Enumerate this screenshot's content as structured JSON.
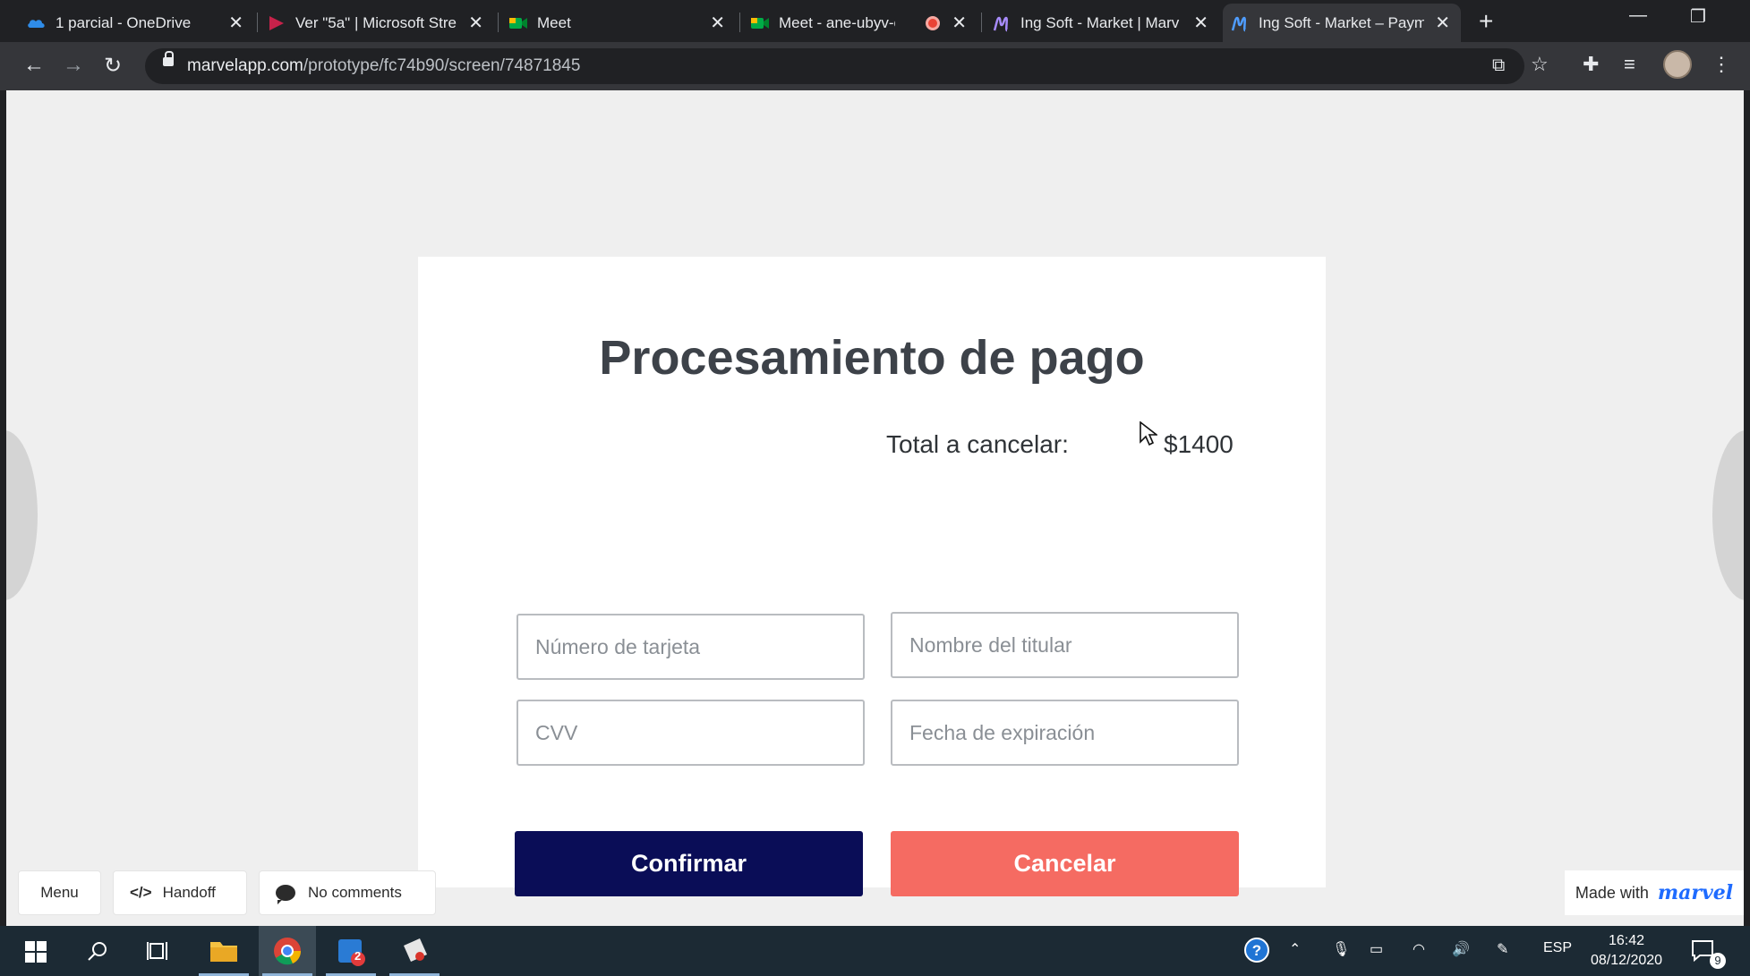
{
  "browser": {
    "tabs": [
      {
        "title": "1 parcial - OneDrive",
        "icon": "onedrive-icon"
      },
      {
        "title": "Ver \"5a\" | Microsoft Stre",
        "icon": "stream-icon"
      },
      {
        "title": "Meet",
        "icon": "meet-icon"
      },
      {
        "title": "Meet - ane-ubyv-c",
        "icon": "meet-icon",
        "recording": true
      },
      {
        "title": "Ing Soft - Market | Marv",
        "icon": "marvel-icon"
      },
      {
        "title": "Ing Soft - Market – Paym",
        "icon": "marvel-icon",
        "active": true
      }
    ],
    "url_host": "marvelapp.com",
    "url_path": "/prototype/fc74b90/screen/74871845"
  },
  "page": {
    "title": "Procesamiento de pago",
    "total_label": "Total a cancelar:",
    "total_value": "$1400",
    "fields": {
      "card_number": {
        "placeholder": "Número de tarjeta",
        "value": ""
      },
      "holder_name": {
        "placeholder": "Nombre del titular",
        "value": ""
      },
      "cvv": {
        "placeholder": "CVV",
        "value": ""
      },
      "expiry": {
        "placeholder": "Fecha de expiración",
        "value": ""
      }
    },
    "buttons": {
      "confirm": "Confirmar",
      "cancel": "Cancelar"
    },
    "colors": {
      "confirm_bg": "#0a0d57",
      "cancel_bg": "#f56b62",
      "title_color": "#3d4249"
    }
  },
  "marvel_bar": {
    "menu": "Menu",
    "handoff": "Handoff",
    "handoff_icon": "</>",
    "comments": "No comments",
    "made_with": "Made with",
    "brand": "marvel"
  },
  "taskbar": {
    "language": "ESP",
    "time": "16:42",
    "date": "08/12/2020",
    "notification_count": "9",
    "mail_badge": "2"
  }
}
